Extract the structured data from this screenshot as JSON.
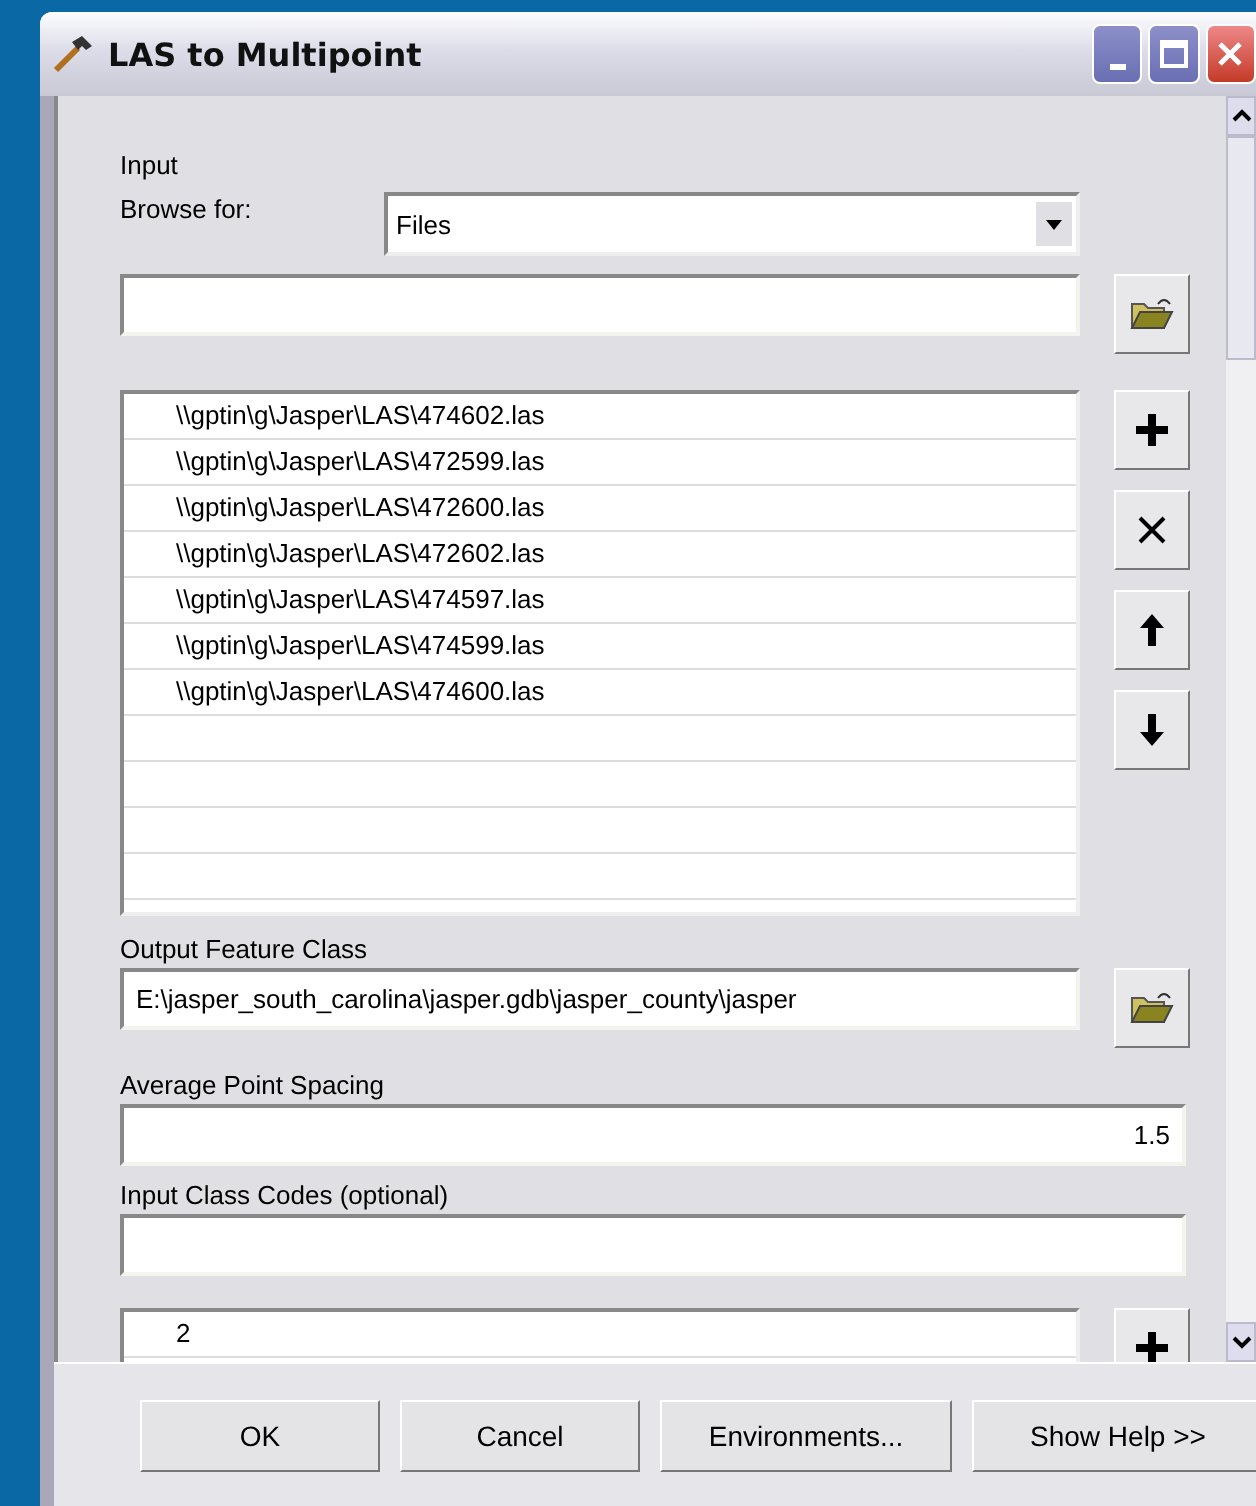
{
  "window": {
    "title": "LAS to Multipoint"
  },
  "input": {
    "heading": "Input",
    "browse_label": "Browse for:",
    "browse_value": "Files"
  },
  "files": [
    "\\\\gptin\\g\\Jasper\\LAS\\474602.las",
    "\\\\gptin\\g\\Jasper\\LAS\\472599.las",
    "\\\\gptin\\g\\Jasper\\LAS\\472600.las",
    "\\\\gptin\\g\\Jasper\\LAS\\472602.las",
    "\\\\gptin\\g\\Jasper\\LAS\\474597.las",
    "\\\\gptin\\g\\Jasper\\LAS\\474599.las",
    "\\\\gptin\\g\\Jasper\\LAS\\474600.las"
  ],
  "output": {
    "label": "Output Feature Class",
    "value": "E:\\jasper_south_carolina\\jasper.gdb\\jasper_county\\jasper"
  },
  "spacing": {
    "label": "Average Point Spacing",
    "value": "1.5"
  },
  "class_codes": {
    "label": "Input Class Codes (optional)",
    "items": [
      "2"
    ]
  },
  "buttons": [
    "OK",
    "Cancel",
    "Environments...",
    "Show Help >>"
  ]
}
